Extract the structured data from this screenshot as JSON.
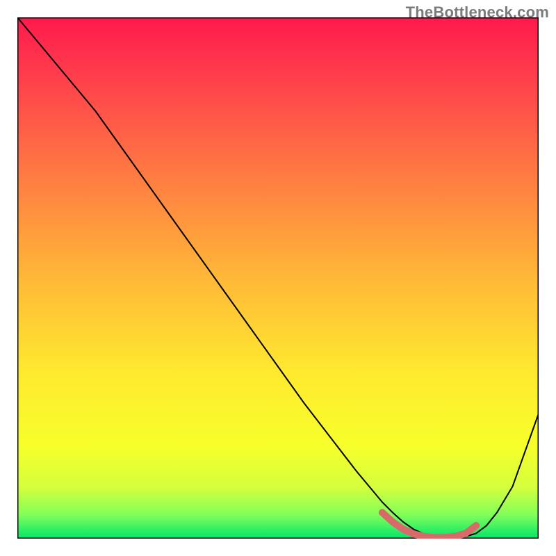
{
  "attribution": "TheBottleneck.com",
  "chart_data": {
    "type": "line",
    "title": "",
    "xlabel": "",
    "ylabel": "",
    "xlim": [
      0,
      100
    ],
    "ylim": [
      0,
      100
    ],
    "series": [
      {
        "name": "bottleneck-curve",
        "x": [
          0,
          5,
          10,
          15,
          20,
          25,
          30,
          35,
          40,
          45,
          50,
          55,
          60,
          65,
          70,
          72,
          74,
          76,
          78,
          80,
          82,
          84,
          86,
          88,
          90,
          92,
          95,
          100
        ],
        "y": [
          100,
          94,
          88,
          82,
          75,
          68,
          61,
          54,
          47,
          40,
          33,
          26,
          19.5,
          13,
          7,
          5,
          3.2,
          1.8,
          0.9,
          0.4,
          0.2,
          0.2,
          0.4,
          1.0,
          2.5,
          5,
          10,
          24
        ],
        "color": "#000000"
      },
      {
        "name": "optimal-range-marker",
        "x": [
          70,
          72,
          74,
          76,
          78,
          80,
          82,
          84,
          86,
          88
        ],
        "y": [
          5.0,
          3.2,
          1.8,
          0.9,
          0.4,
          0.2,
          0.2,
          0.4,
          1.0,
          2.5
        ],
        "color": "#d86a6a",
        "style": "thick-dotted"
      }
    ],
    "background": {
      "type": "vertical-gradient",
      "stops": [
        {
          "pos": 0.0,
          "color": "#ff1a4d"
        },
        {
          "pos": 0.15,
          "color": "#ff4a4a"
        },
        {
          "pos": 0.3,
          "color": "#ff7a42"
        },
        {
          "pos": 0.5,
          "color": "#ffb838"
        },
        {
          "pos": 0.68,
          "color": "#ffe92f"
        },
        {
          "pos": 0.82,
          "color": "#f7ff2a"
        },
        {
          "pos": 0.9,
          "color": "#d6ff3d"
        },
        {
          "pos": 0.955,
          "color": "#7fff5a"
        },
        {
          "pos": 1.0,
          "color": "#00e56a"
        }
      ]
    },
    "border_color": "#000000"
  }
}
